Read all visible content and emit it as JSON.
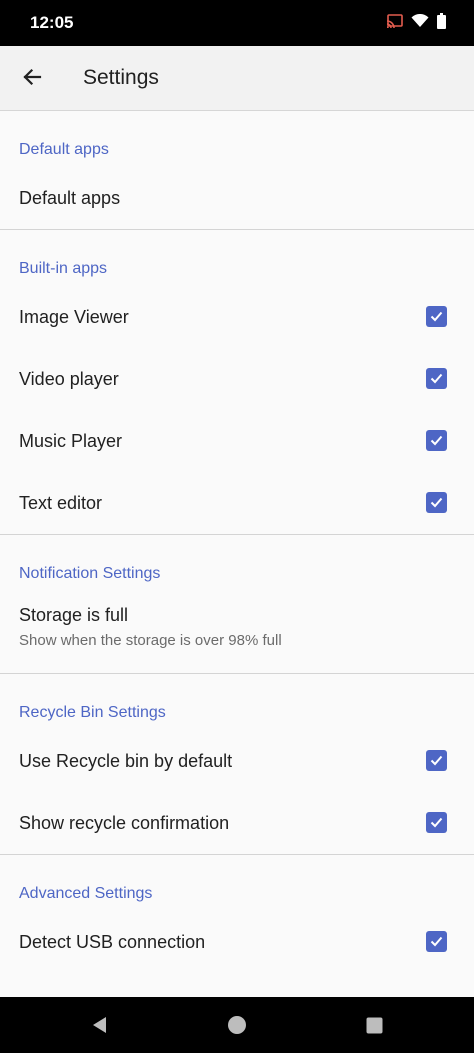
{
  "status_bar": {
    "time": "12:05"
  },
  "app_bar": {
    "title": "Settings"
  },
  "sections": [
    {
      "header": "Default apps",
      "items": [
        {
          "label": "Default apps"
        }
      ]
    },
    {
      "header": "Built-in apps",
      "items": [
        {
          "label": "Image Viewer",
          "checked": true
        },
        {
          "label": "Video player",
          "checked": true
        },
        {
          "label": "Music Player",
          "checked": true
        },
        {
          "label": "Text editor",
          "checked": true
        }
      ]
    },
    {
      "header": "Notification Settings",
      "items": [
        {
          "label": "Storage is full",
          "subtitle": "Show when the storage is over 98% full"
        }
      ]
    },
    {
      "header": "Recycle Bin Settings",
      "items": [
        {
          "label": "Use Recycle bin by default",
          "checked": true
        },
        {
          "label": "Show recycle confirmation",
          "checked": true
        }
      ]
    },
    {
      "header": "Advanced Settings",
      "items": [
        {
          "label": "Detect USB connection",
          "checked": true
        }
      ]
    }
  ],
  "colors": {
    "accent": "#4e66c5",
    "background": "#fafafa",
    "app_bar": "#f2f2f2"
  },
  "icons": {
    "status": [
      "cast-icon",
      "wifi-icon",
      "battery-icon"
    ],
    "nav": [
      "back-nav-icon",
      "home-nav-icon",
      "recents-nav-icon"
    ]
  }
}
